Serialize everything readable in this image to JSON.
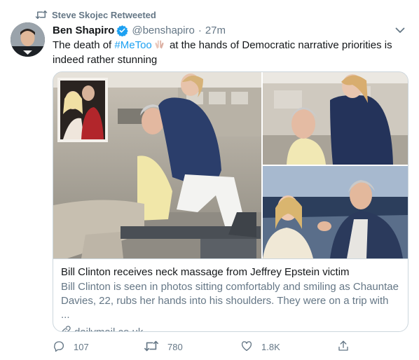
{
  "retweet_context": {
    "text": "Steve Skojec Retweeted"
  },
  "author": {
    "name": "Ben Shapiro",
    "handle": "@benshapiro",
    "separator": "·",
    "time": "27m",
    "verified": true
  },
  "tweet": {
    "text_before": "The death of ",
    "hashtag": "#MeToo",
    "text_after": " at the hands of Democratic narrative priorities is indeed rather stunning"
  },
  "card": {
    "title": "Bill Clinton receives neck massage from Jeffrey Epstein victim",
    "description": "Bill Clinton is seen in photos sitting comfortably and smiling as Chauntae Davies, 22, rubs her hands into his shoulders. They were on a trip with ...",
    "domain": "dailymail.co.uk"
  },
  "actions": {
    "replies": "107",
    "retweets": "780",
    "likes": "1.8K"
  },
  "colors": {
    "accent": "#1da1f2",
    "muted": "#657786",
    "border": "#ccd6dd",
    "text": "#14171a"
  },
  "icons": [
    "retweet-icon",
    "verified-badge-icon",
    "chevron-down-icon",
    "raising-hands-emoji-icon",
    "link-icon",
    "reply-icon",
    "like-icon",
    "share-icon"
  ]
}
